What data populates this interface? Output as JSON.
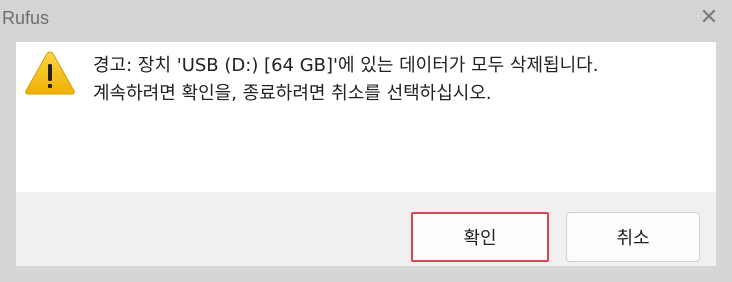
{
  "window": {
    "title": "Rufus",
    "close_glyph": "✕"
  },
  "message": {
    "line1": "경고: 장치 'USB (D:) [64 GB]'에 있는 데이터가 모두 삭제됩니다.",
    "line2": "계속하려면 확인을, 종료하려면 취소를 선택하십시오."
  },
  "buttons": {
    "ok_label": "확인",
    "cancel_label": "취소"
  },
  "colors": {
    "warning_fill": "#f6c11b",
    "focus_border": "#e0444e"
  },
  "icons": {
    "warning": "warning-triangle-icon",
    "close": "close-icon"
  }
}
